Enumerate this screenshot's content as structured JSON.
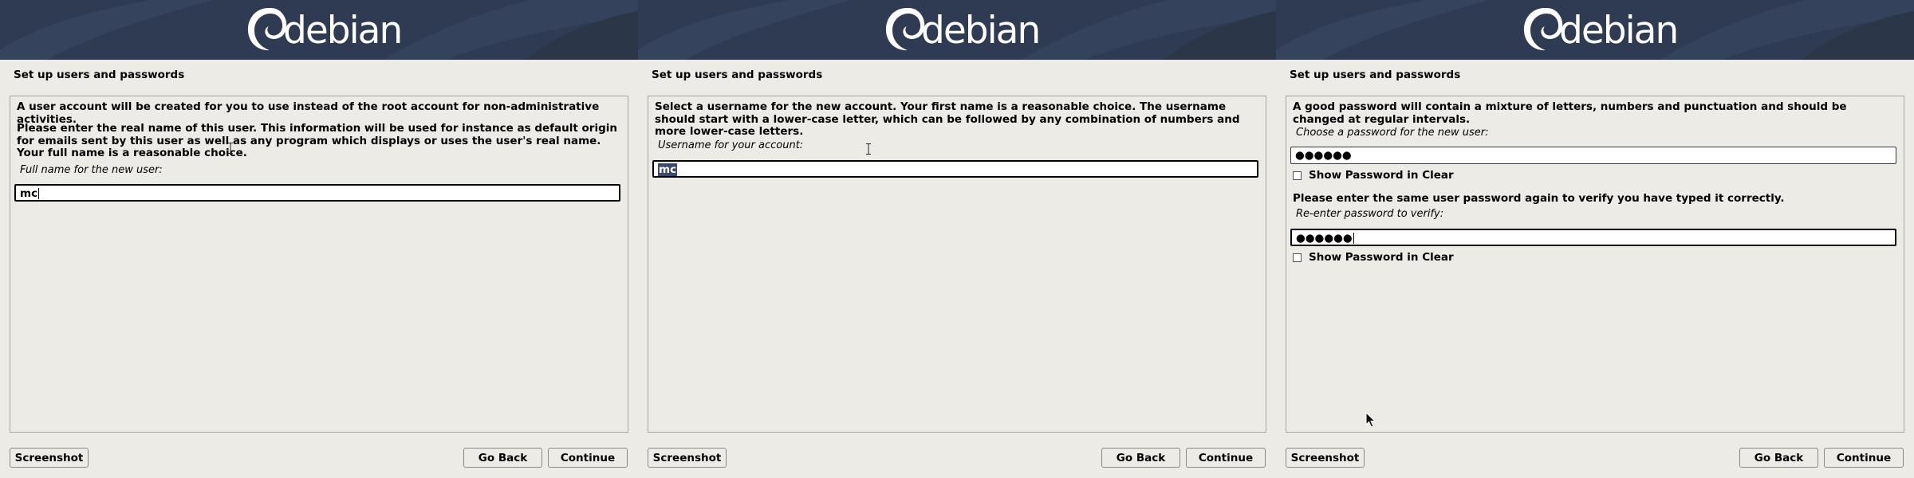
{
  "brand": {
    "logo_text": "debian",
    "banner_color": "#2f3b52",
    "background_color": "#edebe6",
    "selection_color": "#3c4a6e"
  },
  "panels": [
    {
      "title": "Set up users and passwords",
      "paragraphs": [
        "A user account will be created for you to use instead of the root account for non-administrative activities.",
        "Please enter the real name of this user. This information will be used for instance as default origin for emails sent by this user as well as any program which displays or uses the user's real name. Your full name is a reasonable choice."
      ],
      "field_label": "Full name for the new user:",
      "field_value": "mc",
      "buttons": {
        "screenshot": "Screenshot",
        "back": "Go Back",
        "continue": "Continue"
      }
    },
    {
      "title": "Set up users and passwords",
      "paragraphs": [
        "Select a username for the new account. Your first name is a reasonable choice. The username should start with a lower-case letter, which can be followed by any combination of numbers and more lower-case letters."
      ],
      "field_label": "Username for your account:",
      "field_value": "mc",
      "buttons": {
        "screenshot": "Screenshot",
        "back": "Go Back",
        "continue": "Continue"
      }
    },
    {
      "title": "Set up users and passwords",
      "intro": "A good password will contain a mixture of letters, numbers and punctuation and should be changed at regular intervals.",
      "password_label": "Choose a password for the new user:",
      "password_value": "●●●●●●",
      "show_password_label": "Show Password in Clear",
      "verify_text": "Please enter the same user password again to verify you have typed it correctly.",
      "verify_label": "Re-enter password to verify:",
      "verify_value": "●●●●●●",
      "show_password_label_2": "Show Password in Clear",
      "buttons": {
        "screenshot": "Screenshot",
        "back": "Go Back",
        "continue": "Continue"
      }
    }
  ]
}
